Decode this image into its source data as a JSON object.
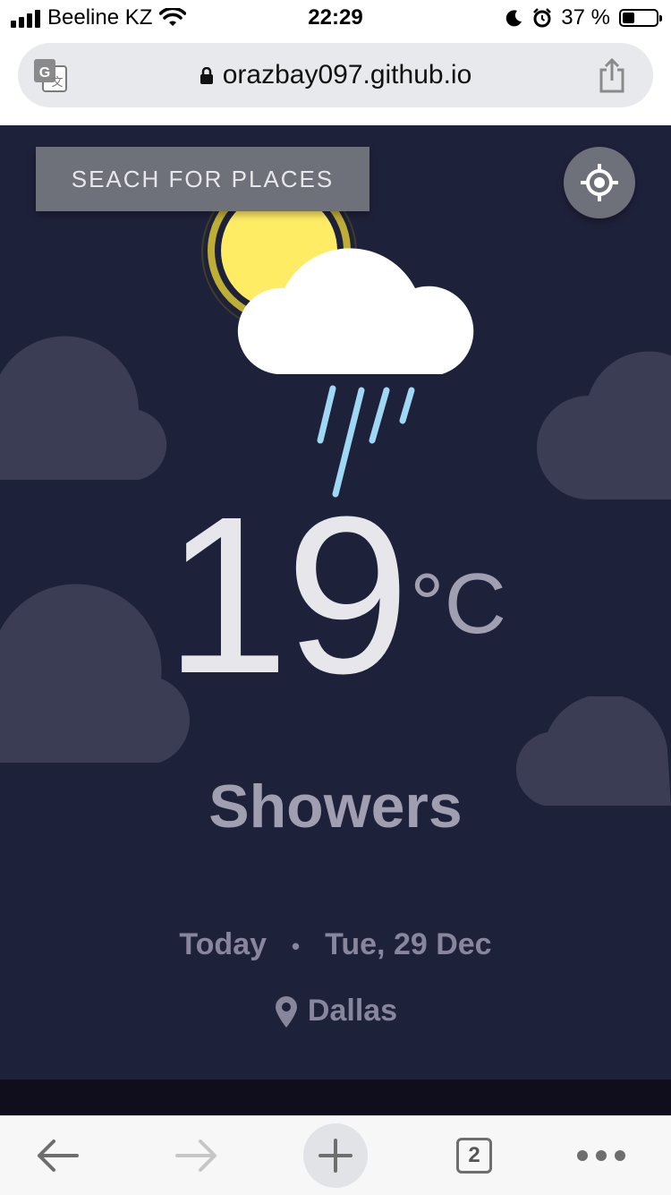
{
  "status_bar": {
    "carrier": "Beeline KZ",
    "time": "22:29",
    "battery_percent": "37 %",
    "battery_level": 0.37,
    "icons": [
      "signal-icon",
      "wifi-icon",
      "moon-icon",
      "alarm-icon",
      "battery-icon"
    ]
  },
  "browser": {
    "url": "orazbay097.github.io",
    "tabs_count": "2",
    "icons": [
      "translate-icon",
      "lock-icon",
      "share-icon",
      "back-icon",
      "forward-icon",
      "new-tab-icon",
      "more-icon"
    ]
  },
  "weather": {
    "search_label": "SEACH FOR PLACES",
    "temperature": "19",
    "unit": "°C",
    "condition": "Showers",
    "day_label": "Today",
    "separator": "•",
    "date": "Tue, 29 Dec",
    "location": "Dallas",
    "icons": [
      "location-target-icon",
      "sun-cloud-rain-icon",
      "map-pin-icon"
    ]
  },
  "colors": {
    "panel_bg": "#1e213a",
    "button_bg": "#6e707a",
    "text_primary": "#e7e7eb",
    "text_secondary": "#a09fb1",
    "text_muted": "#88869d",
    "rain": "#9ed8f5",
    "sun": "#ffec65"
  }
}
